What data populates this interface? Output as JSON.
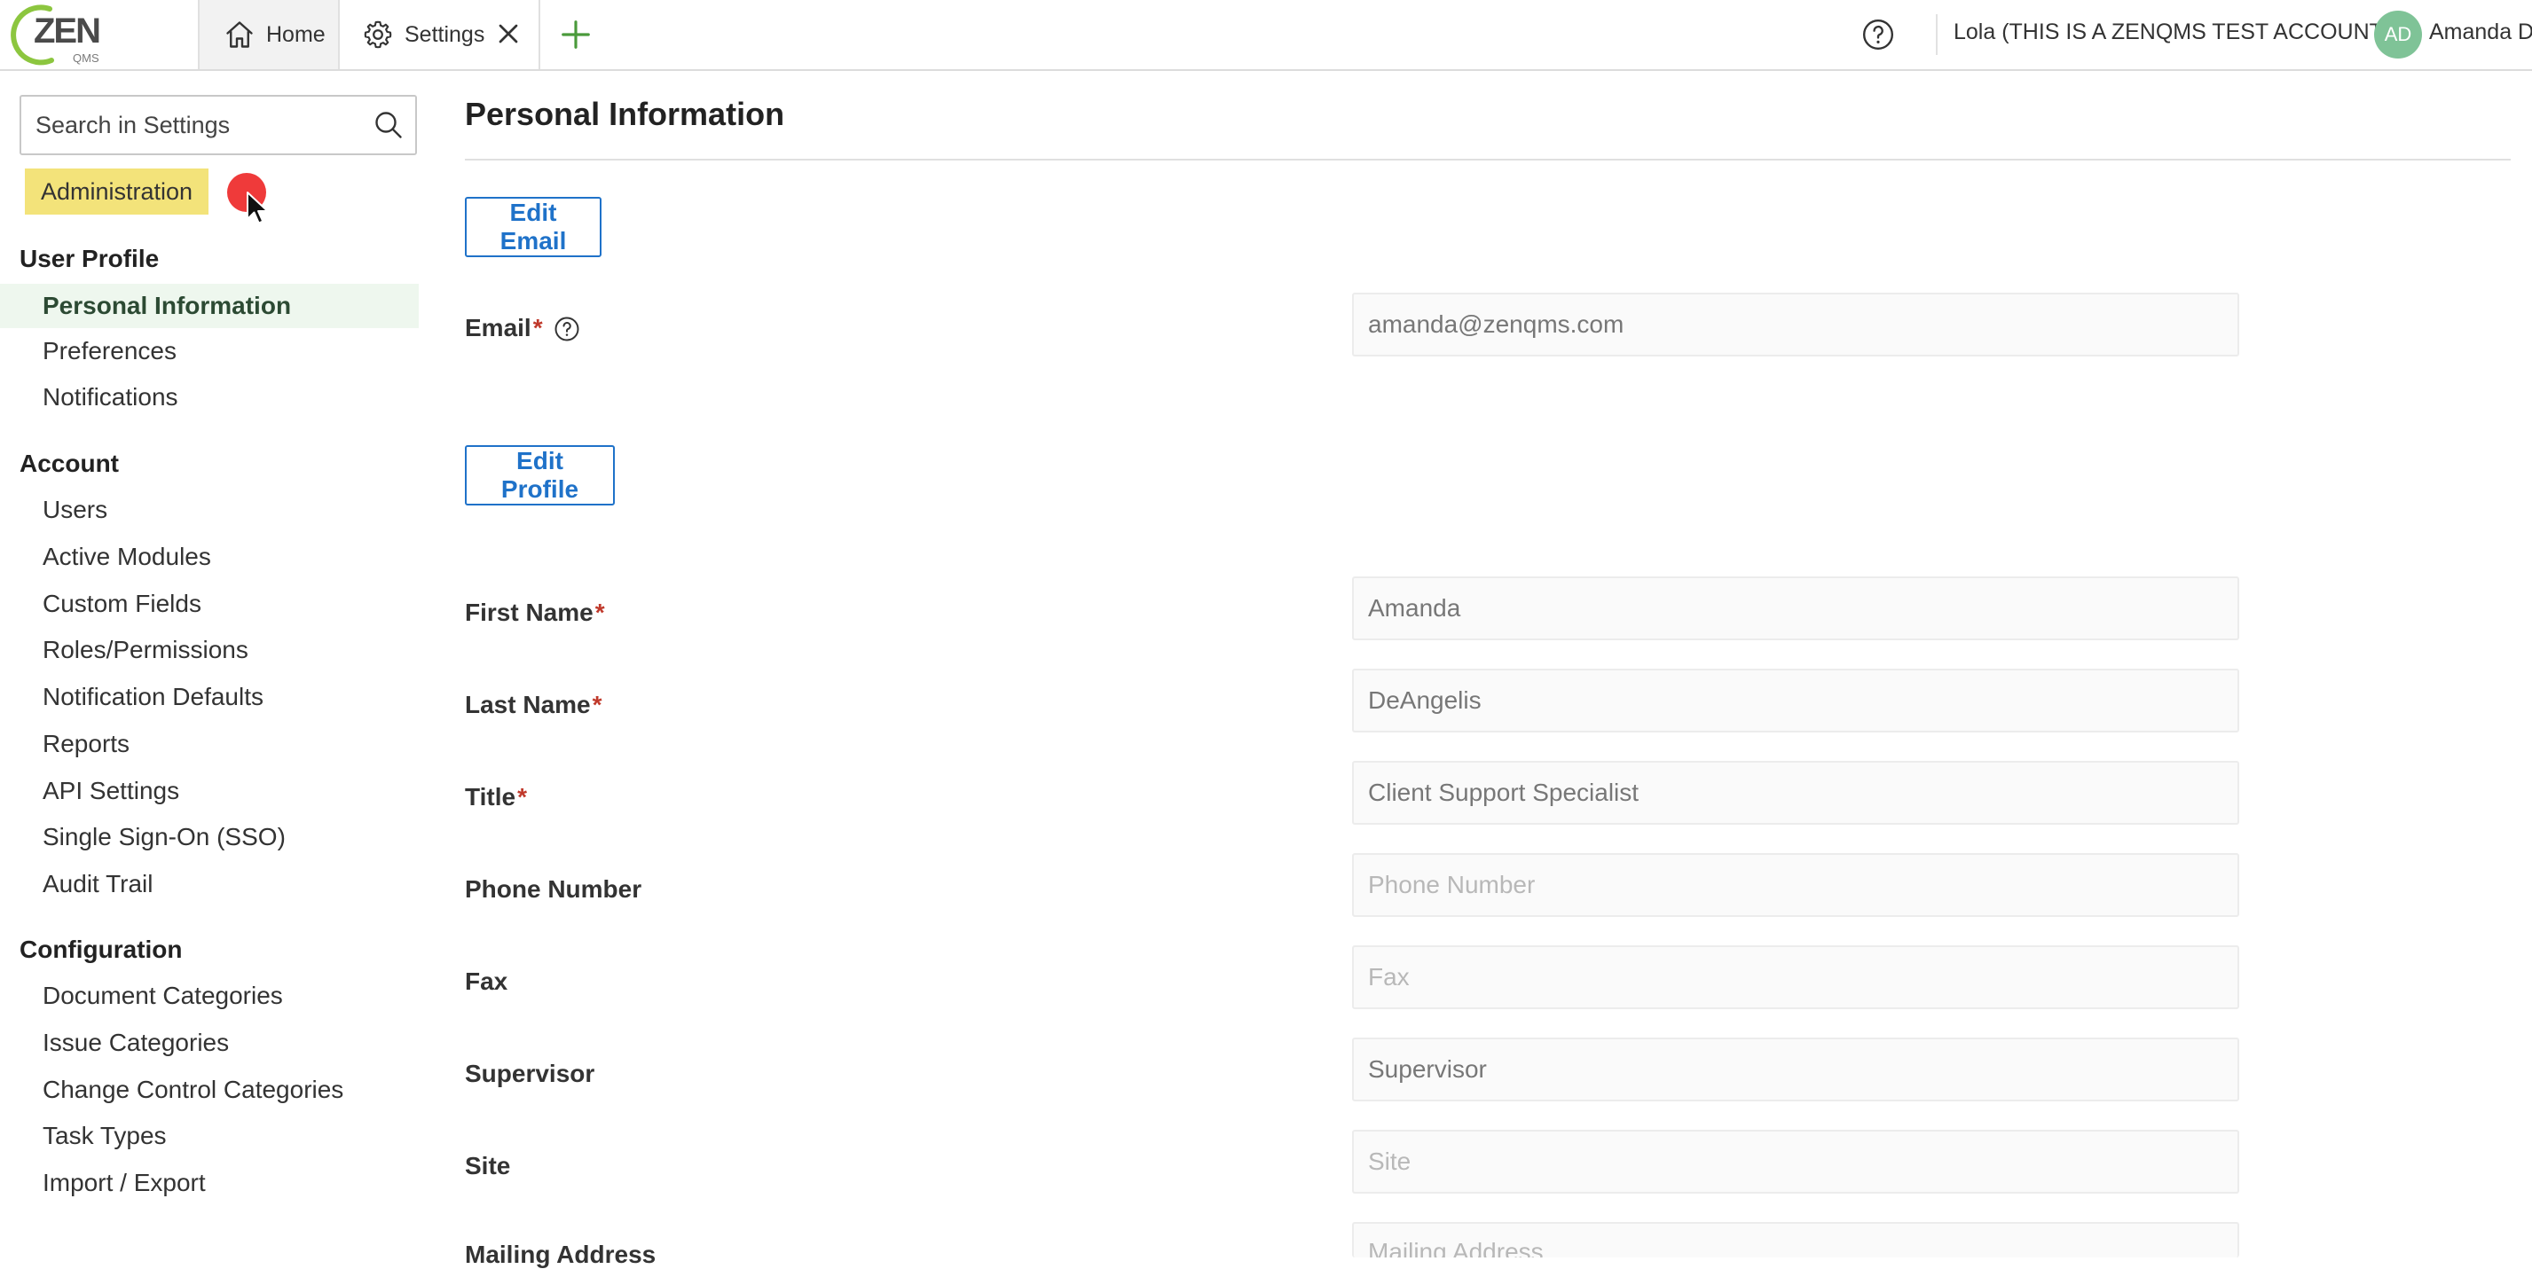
{
  "topbar": {
    "logo_text": "ZEN",
    "logo_subtext": "QMS",
    "tabs": [
      {
        "label": "Home",
        "icon": "home-icon"
      },
      {
        "label": "Settings",
        "icon": "gear-icon"
      }
    ],
    "account_label": "Lola (THIS IS A ZENQMS TEST ACCOUNT)",
    "avatar_initials": "AD",
    "user_name": "Amanda D"
  },
  "sidebar": {
    "search": {
      "placeholder": "Search in Settings",
      "value": ""
    },
    "admin_badge": "Administration",
    "groups": [
      {
        "title": "User Profile",
        "items": [
          "Personal Information",
          "Preferences",
          "Notifications"
        ]
      },
      {
        "title": "Account",
        "items": [
          "Users",
          "Active Modules",
          "Custom Fields",
          "Roles/Permissions",
          "Notification Defaults",
          "Reports",
          "API Settings",
          "Single Sign-On (SSO)",
          "Audit Trail"
        ]
      },
      {
        "title": "Configuration",
        "items": [
          "Document Categories",
          "Issue Categories",
          "Change Control Categories",
          "Task Types",
          "Import / Export"
        ]
      }
    ],
    "active_item": "Personal Information"
  },
  "main": {
    "title": "Personal Information",
    "edit_email_label": "Edit Email",
    "edit_profile_label": "Edit Profile",
    "email": {
      "label": "Email",
      "required_mark": "*",
      "value": "amanda@zenqms.com"
    },
    "fields": [
      {
        "label": "First Name",
        "required": "*",
        "value": "Amanda",
        "placeholder": ""
      },
      {
        "label": "Last Name",
        "required": "*",
        "value": "DeAngelis",
        "placeholder": ""
      },
      {
        "label": "Title",
        "required": "*",
        "value": "Client Support Specialist",
        "placeholder": ""
      },
      {
        "label": "Phone Number",
        "required": "",
        "value": "",
        "placeholder": "Phone Number"
      },
      {
        "label": "Fax",
        "required": "",
        "value": "",
        "placeholder": "Fax"
      },
      {
        "label": "Supervisor",
        "required": "",
        "value": "Supervisor",
        "placeholder": ""
      },
      {
        "label": "Site",
        "required": "",
        "value": "",
        "placeholder": "Site"
      },
      {
        "label": "Mailing Address",
        "required": "",
        "value": "",
        "placeholder": "Mailing Address"
      }
    ]
  },
  "colors": {
    "accent_blue": "#1f72c9",
    "logo_green": "#8cc63f",
    "admin_highlight": "#f3e37a",
    "active_nav_bg": "#eef7ee",
    "required_red": "#c0392b",
    "avatar_green": "#7fc397"
  }
}
